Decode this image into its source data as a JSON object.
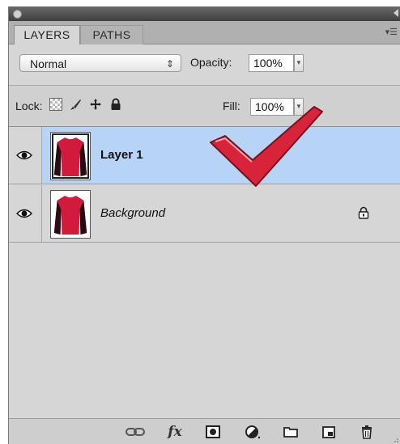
{
  "tabs": [
    {
      "label": "LAYERS",
      "active": true
    },
    {
      "label": "PATHS",
      "active": false
    }
  ],
  "panel_menu_icon": "panel-menu-icon",
  "blend": {
    "mode": "Normal",
    "opacity_label": "Opacity:",
    "opacity_value": "100%"
  },
  "lock": {
    "label": "Lock:",
    "fill_label": "Fill:",
    "fill_value": "100%",
    "icons": [
      "lock-transparent-icon",
      "lock-image-brush-icon",
      "lock-position-move-icon",
      "lock-all-icon"
    ]
  },
  "layers": [
    {
      "name": "Layer 1",
      "visible": true,
      "selected": true,
      "thumbnail": "red-sweater-icon"
    },
    {
      "name": "Background",
      "visible": true,
      "selected": false,
      "locked": true,
      "thumbnail": "red-sweater-icon"
    }
  ],
  "bottom_bar": {
    "fx_label": "fx",
    "icons": [
      "link-layers-icon",
      "layer-style-fx-icon",
      "add-mask-icon",
      "adjustment-layer-icon",
      "new-group-folder-icon",
      "new-layer-icon",
      "delete-trash-icon"
    ]
  },
  "colors": {
    "selected_row": "#b7d4f7",
    "panel_bg": "#d6d6d6",
    "checkmark": "#d8243a"
  }
}
